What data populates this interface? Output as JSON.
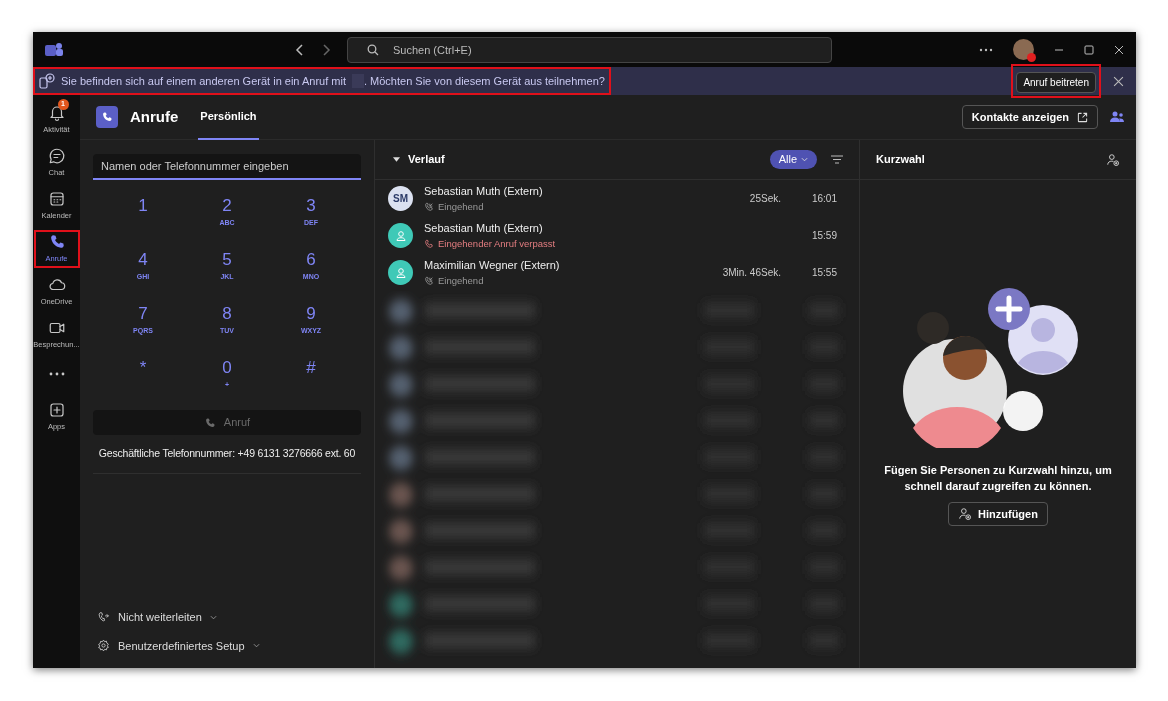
{
  "title_bar": {
    "search_placeholder": "Suchen (Ctrl+E)"
  },
  "banner": {
    "message_before": "Sie befinden sich auf einem anderen Gerät in ein Anruf mit",
    "message_after": ". Möchten Sie von diesem Gerät aus teilnehmen?",
    "button": "Anruf beitreten",
    "message_highlighted": true,
    "button_highlighted": true
  },
  "rail": [
    {
      "kind": "bell",
      "label": "Aktivität",
      "badge": "1",
      "selected": false,
      "highlighted": false
    },
    {
      "kind": "chat",
      "label": "Chat",
      "selected": false,
      "highlighted": false
    },
    {
      "kind": "calendar",
      "label": "Kalender",
      "selected": false,
      "highlighted": false
    },
    {
      "kind": "phone",
      "label": "Anrufe",
      "selected": true,
      "highlighted": true
    },
    {
      "kind": "cloud",
      "label": "OneDrive",
      "selected": false,
      "highlighted": false
    },
    {
      "kind": "video",
      "label": "Besprechun...",
      "selected": false,
      "highlighted": false
    },
    {
      "kind": "more",
      "selected": false,
      "highlighted": false
    },
    {
      "kind": "apps",
      "label": "Apps",
      "selected": false,
      "highlighted": false
    }
  ],
  "header": {
    "title": "Anrufe",
    "tabs": [
      {
        "label": "Persönlich",
        "selected": true
      }
    ],
    "contacts_button": "Kontakte anzeigen"
  },
  "dialer": {
    "placeholder": "Namen oder Telefonnummer eingeben",
    "keys": [
      {
        "digit": "1"
      },
      {
        "digit": "2",
        "letters": "ABC"
      },
      {
        "digit": "3",
        "letters": "DEF"
      },
      {
        "digit": "4",
        "letters": "GHI"
      },
      {
        "digit": "5",
        "letters": "JKL"
      },
      {
        "digit": "6",
        "letters": "MNO"
      },
      {
        "digit": "7",
        "letters": "PQRS"
      },
      {
        "digit": "8",
        "letters": "TUV"
      },
      {
        "digit": "9",
        "letters": "WXYZ"
      },
      {
        "digit": "*"
      },
      {
        "digit": "0",
        "letters": "+"
      },
      {
        "digit": "#"
      }
    ],
    "call_button": "Anruf",
    "call_disabled": true,
    "business_number": "Geschäftliche Telefonnummer: +49 6131 3276666 ext. 60",
    "options": [
      {
        "kind": "forward",
        "label": "Nicht weiterleiten"
      },
      {
        "kind": "settings",
        "label": "Benutzerdefiniertes Setup"
      }
    ]
  },
  "history": {
    "title": "Verlauf",
    "filter": "Alle",
    "rows": [
      {
        "name": "Sebastian Muth (Extern)",
        "kind": "incoming",
        "status": "Eingehend",
        "duration": "25Sek.",
        "time": "16:01",
        "avatar": {
          "kind": "initials",
          "text": "SM"
        }
      },
      {
        "name": "Sebastian Muth (Extern)",
        "kind": "missed",
        "status": "Eingehender Anruf verpasst",
        "time": "15:59",
        "avatar": {
          "kind": "person"
        }
      },
      {
        "name": "Maximilian Wegner (Extern)",
        "kind": "incoming",
        "status": "Eingehend",
        "duration": "3Min. 46Sek.",
        "time": "15:55",
        "avatar": {
          "kind": "person"
        }
      }
    ]
  },
  "speed_dial": {
    "title": "Kurzwahl",
    "message": "Fügen Sie Personen zu Kurzwahl hinzu, um schnell darauf zugreifen zu können.",
    "button": "Hinzufügen"
  }
}
